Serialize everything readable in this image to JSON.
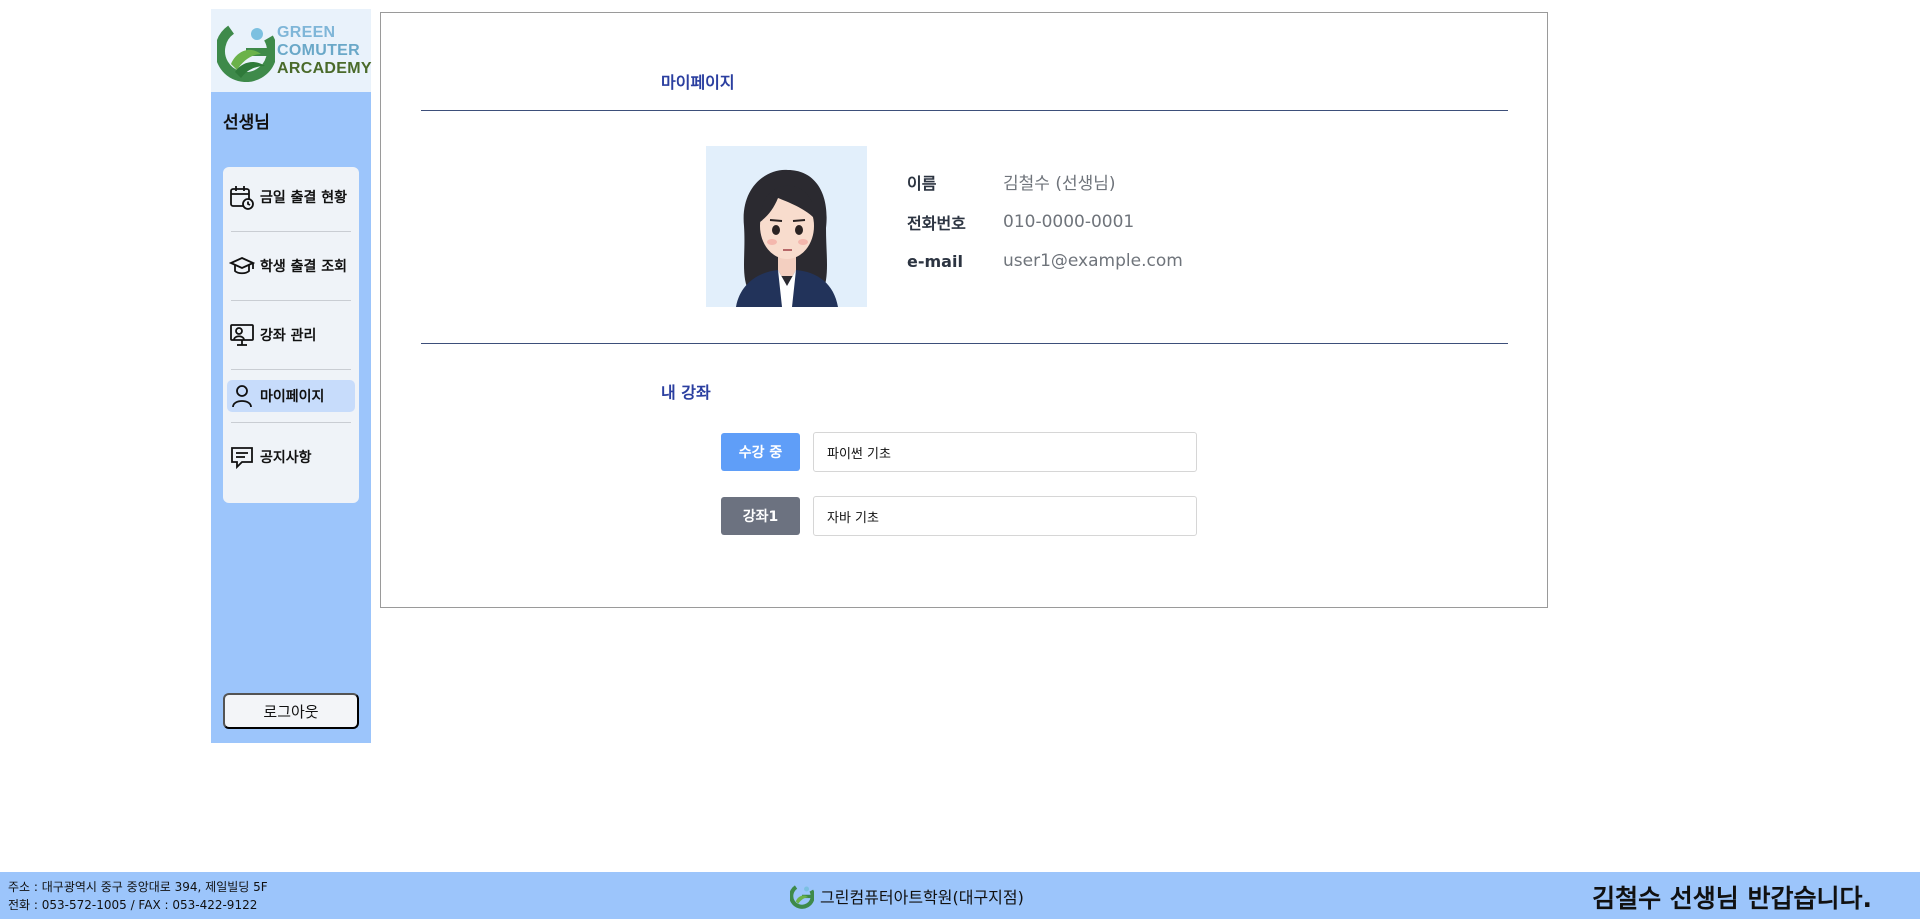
{
  "logo": {
    "line1": "GREEN",
    "line2": "COMUTER",
    "line3": "ARCADEMY"
  },
  "sidebar": {
    "title": "선생님",
    "items": [
      {
        "label": "금일 출결 현황",
        "icon": "calendar-clock-icon"
      },
      {
        "label": "학생 출결 조회",
        "icon": "graduation-cap-icon"
      },
      {
        "label": "강좌 관리",
        "icon": "lecture-board-icon"
      },
      {
        "label": "마이페이지",
        "icon": "user-icon",
        "active": true
      },
      {
        "label": "공지사항",
        "icon": "message-icon"
      }
    ],
    "logout_label": "로그아웃"
  },
  "mypage": {
    "title": "마이페이지",
    "photo_icon": "teacher-avatar-illustration",
    "name_label": "이름",
    "name_value": "김철수 (선생님)",
    "phone_label": "전화번호",
    "phone_value": "010-0000-0001",
    "email_label": "e-mail",
    "email_value": "user1@example.com"
  },
  "courses": {
    "title": "내 강좌",
    "rows": [
      {
        "badge": "수강 중",
        "name": "파이썬 기초",
        "badge_color": "#5f9ef8"
      },
      {
        "badge": "강좌1",
        "name": "자바 기초",
        "badge_color": "#6c7280"
      }
    ]
  },
  "footer": {
    "address": "주소 : 대구광역시 중구 중앙대로 394, 제일빌딩 5F",
    "contact": "전화 : 053-572-1005 / FAX : 053-422-9122",
    "academy": "그린컴퓨터아트학원(대구지점)",
    "greeting": "김철수 선생님 반갑습니다."
  },
  "colors": {
    "sidebar_bg": "#9cc5fb",
    "title_blue": "#2b3fa0",
    "badge_active": "#5f9ef8",
    "badge_inactive": "#6c7280"
  }
}
